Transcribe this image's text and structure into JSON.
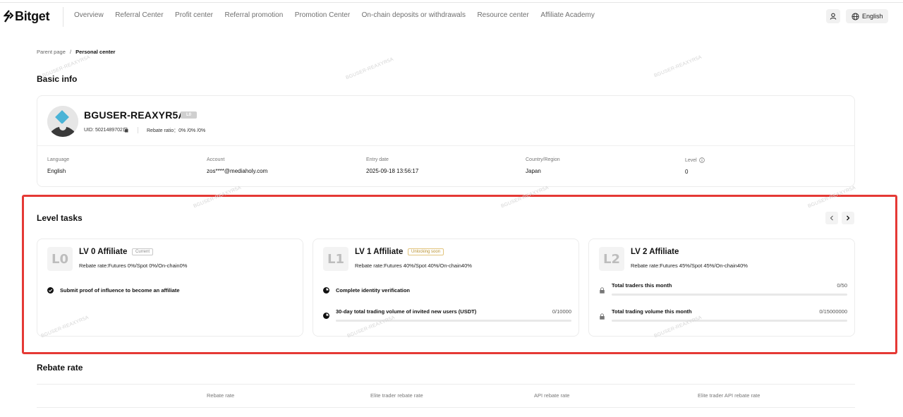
{
  "header": {
    "brand": "Bitget",
    "nav": [
      "Overview",
      "Referral Center",
      "Profit center",
      "Referral promotion",
      "Promotion Center",
      "On-chain deposits or withdrawals",
      "Resource center",
      "Affiliate Academy"
    ],
    "language": "English"
  },
  "breadcrumb": {
    "parent": "Parent page",
    "separator": "/",
    "current": "Personal center"
  },
  "basic_info": {
    "title": "Basic info",
    "username": "BGUSER-REAXYR5A",
    "level_badge": "L0",
    "uid_label": "UID: 5021489702",
    "rebate_ratio": "Rebate ratio：0% /0% /0%",
    "fields": [
      {
        "label": "Language",
        "value": "English"
      },
      {
        "label": "Account",
        "value": "zos****@mediaholy.com"
      },
      {
        "label": "Entry date",
        "value": "2025-09-18 13:56:17"
      },
      {
        "label": "Country/Region",
        "value": "Japan"
      },
      {
        "label": "Level",
        "value": "0"
      }
    ]
  },
  "level_tasks": {
    "title": "Level tasks",
    "cards": [
      {
        "icon": "L0",
        "title": "LV 0 Affiliate",
        "tag": "Current",
        "rate": "Rebate rate:Futures 0%/Spot 0%/On-chain0%",
        "tasks": [
          {
            "name": "Submit proof of influence to become an affiliate",
            "progress": "",
            "status": "check-icon"
          }
        ]
      },
      {
        "icon": "L1",
        "title": "LV 1 Affiliate",
        "tag": "Unlocking soon",
        "rate": "Rebate rate:Futures 40%/Spot 40%/On-chain40%",
        "tasks": [
          {
            "name": "Complete identity verification",
            "progress": "",
            "status": "pending-icon"
          },
          {
            "name": "30-day total trading volume of invited new users (USDT)",
            "progress": "0/10000",
            "status": "pending-icon",
            "fill": 0
          }
        ]
      },
      {
        "icon": "L2",
        "title": "LV 2 Affiliate",
        "tag": "",
        "rate": "Rebate rate:Futures 45%/Spot 45%/On-chain40%",
        "tasks": [
          {
            "name": "Total traders this month",
            "progress": "0/50",
            "status": "lock-icon",
            "fill": 0
          },
          {
            "name": "Total trading volume this month",
            "progress": "0/15000000",
            "status": "lock-icon",
            "fill": 0
          }
        ]
      }
    ]
  },
  "rebate_rate": {
    "title": "Rebate rate",
    "columns": [
      "Rebate rate",
      "Elite trader rebate rate",
      "API rebate rate",
      "Elite trader API rebate rate"
    ]
  },
  "watermark": "BGUSER-REAXYR5A",
  "colors": {
    "highlight": "#e53935",
    "tag_current": "#8a8a8a",
    "tag_unlocking": "#c9a24a"
  }
}
